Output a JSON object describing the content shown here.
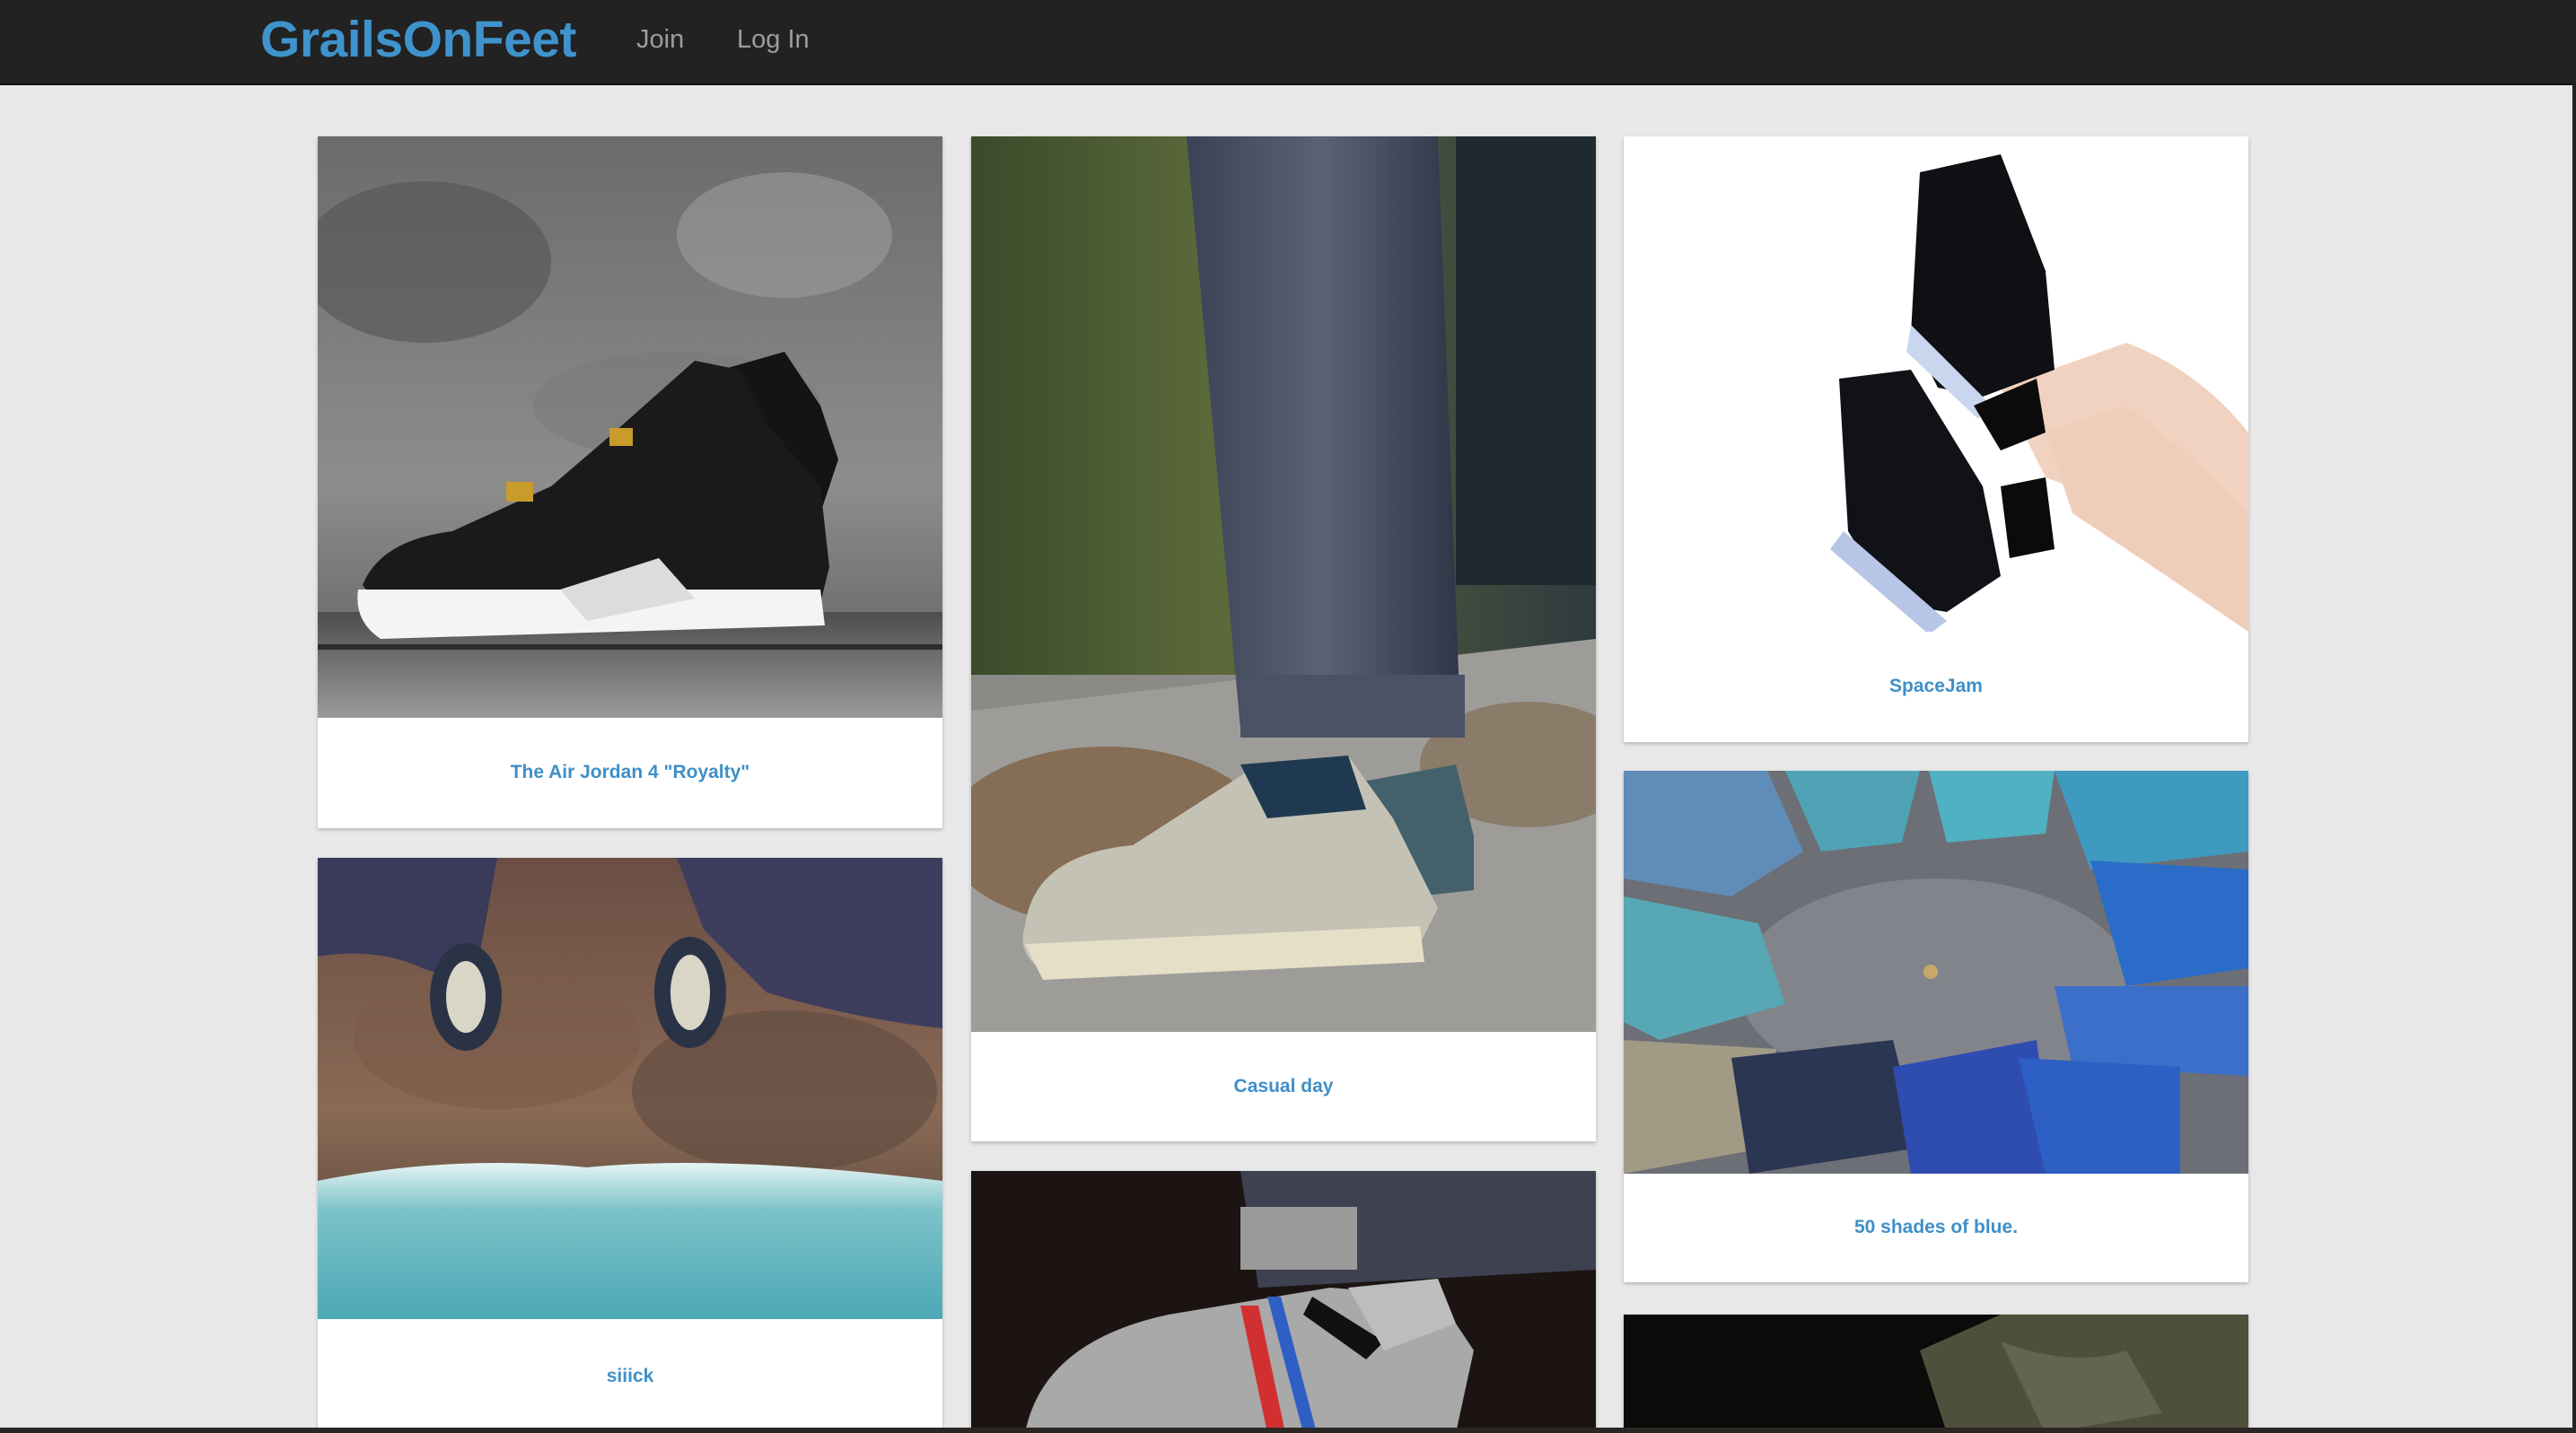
{
  "navbar": {
    "brand": "GrailsOnFeet",
    "links": {
      "join": "Join",
      "login": "Log In"
    }
  },
  "colors": {
    "brand": "#3f93cc",
    "navbar_bg": "#222222",
    "page_bg": "#e8e8e8",
    "caption": "#3f8fc7"
  },
  "posts": [
    {
      "caption": "The Air Jordan 4 \"Royalty\"",
      "image": "black-sneaker-photo"
    },
    {
      "caption": "siiick",
      "image": "cliff-ocean-feet-photo"
    },
    {
      "caption": "Casual day",
      "image": "grey-sneaker-jeans-photo"
    },
    {
      "caption": "",
      "image": "knit-sneaker-photo"
    },
    {
      "caption": "SpaceJam",
      "image": "spacejam-legs-photo"
    },
    {
      "caption": "50 shades of blue.",
      "image": "blue-sneakers-circle-photo"
    },
    {
      "caption": "",
      "image": "dark-olive-pants-photo"
    }
  ]
}
